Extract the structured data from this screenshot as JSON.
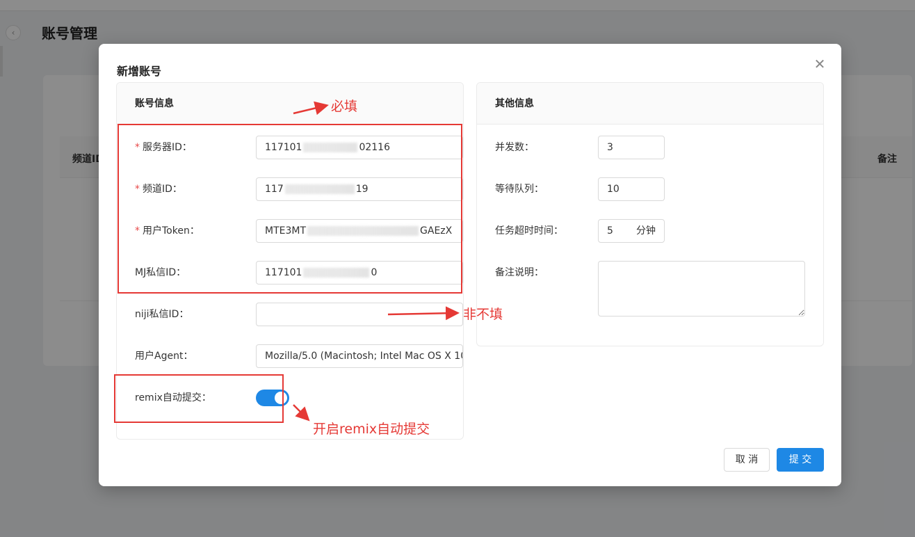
{
  "page": {
    "title": "账号管理",
    "table_headers": [
      "频道ID",
      "备注"
    ]
  },
  "modal": {
    "title": "新增账号",
    "close_icon": "close-icon",
    "left_panel": {
      "title": "账号信息",
      "fields": [
        {
          "label": "服务器ID：",
          "required": true,
          "value_prefix": "117101",
          "value_suffix": "02116"
        },
        {
          "label": "频道ID：",
          "required": true,
          "value_prefix": "117",
          "value_suffix": "19"
        },
        {
          "label": "用户Token：",
          "required": true,
          "value_prefix": "MTE3MT",
          "value_suffix": "GAEzX"
        },
        {
          "label": "MJ私信ID：",
          "required": false,
          "value_prefix": "117101",
          "value_suffix": "0"
        },
        {
          "label": "niji私信ID：",
          "required": false,
          "value_prefix": "",
          "value_suffix": ""
        },
        {
          "label": "用户Agent：",
          "required": false,
          "value_prefix": "Mozilla/5.0 (Macintosh; Intel Mac OS X 10",
          "value_suffix": ""
        }
      ],
      "remix": {
        "label": "remix自动提交：",
        "enabled": true
      }
    },
    "right_panel": {
      "title": "其他信息",
      "fields": [
        {
          "label": "并发数：",
          "value": "3"
        },
        {
          "label": "等待队列：",
          "value": "10"
        },
        {
          "label": "任务超时时间：",
          "value": "5",
          "unit": "分钟"
        },
        {
          "label": "备注说明：",
          "value": ""
        }
      ]
    },
    "buttons": {
      "cancel": "取 消",
      "submit": "提 交"
    }
  },
  "annotations": {
    "required": "必填",
    "optional": "非不填",
    "remix": "开启remix自动提交",
    "color": "#e53935"
  }
}
